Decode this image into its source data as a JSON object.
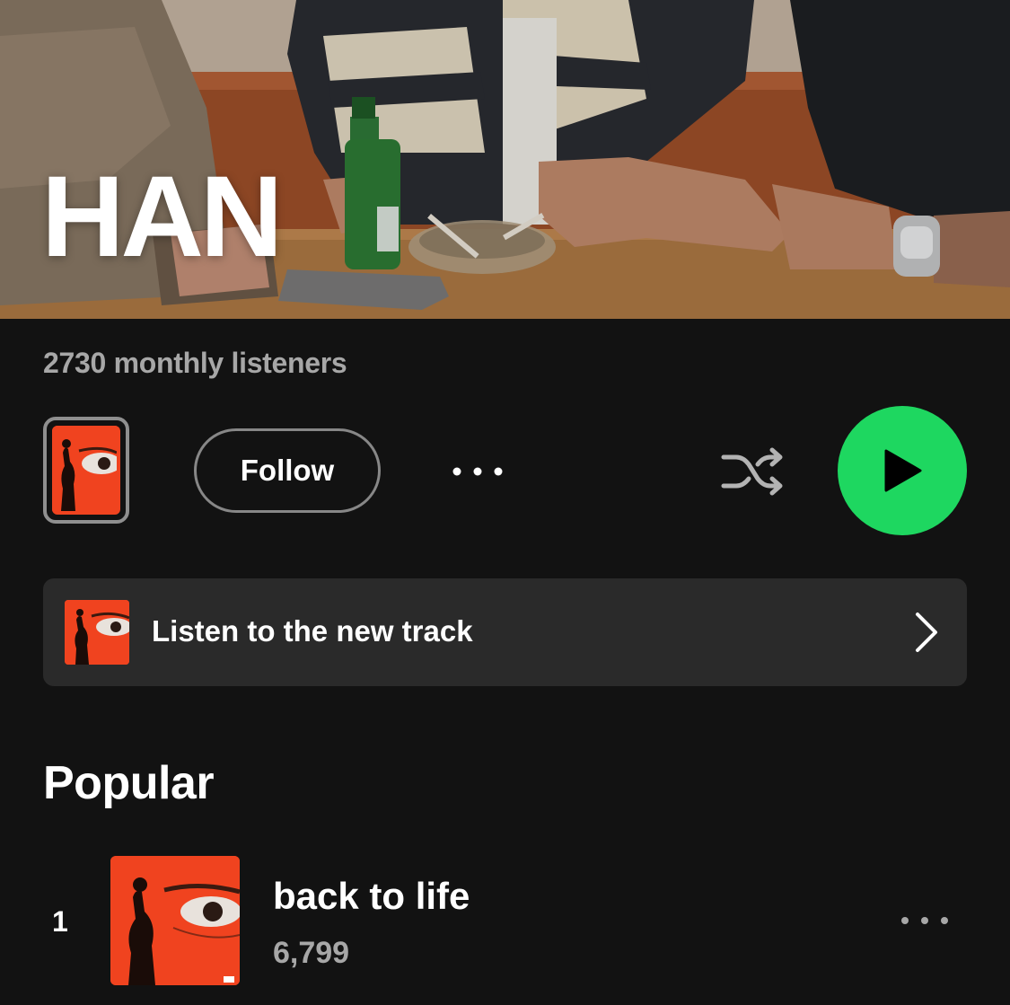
{
  "artist": {
    "name": "HAN",
    "monthly_listeners": "2730 monthly listeners"
  },
  "actions": {
    "follow_label": "Follow"
  },
  "new_release": {
    "label": "Listen to the new track"
  },
  "popular": {
    "title": "Popular",
    "tracks": [
      {
        "rank": "1",
        "title": "back to life",
        "plays": "6,799"
      }
    ]
  },
  "colors": {
    "background": "#121212",
    "accent_green": "#1ed760",
    "cover_red": "#f0431f",
    "secondary_text": "#a7a7a7",
    "banner_bg": "#2a2a2a"
  },
  "icons": {
    "more": "more-horizontal-icon",
    "shuffle": "shuffle-icon",
    "play": "play-icon",
    "chevron": "chevron-right-icon"
  }
}
